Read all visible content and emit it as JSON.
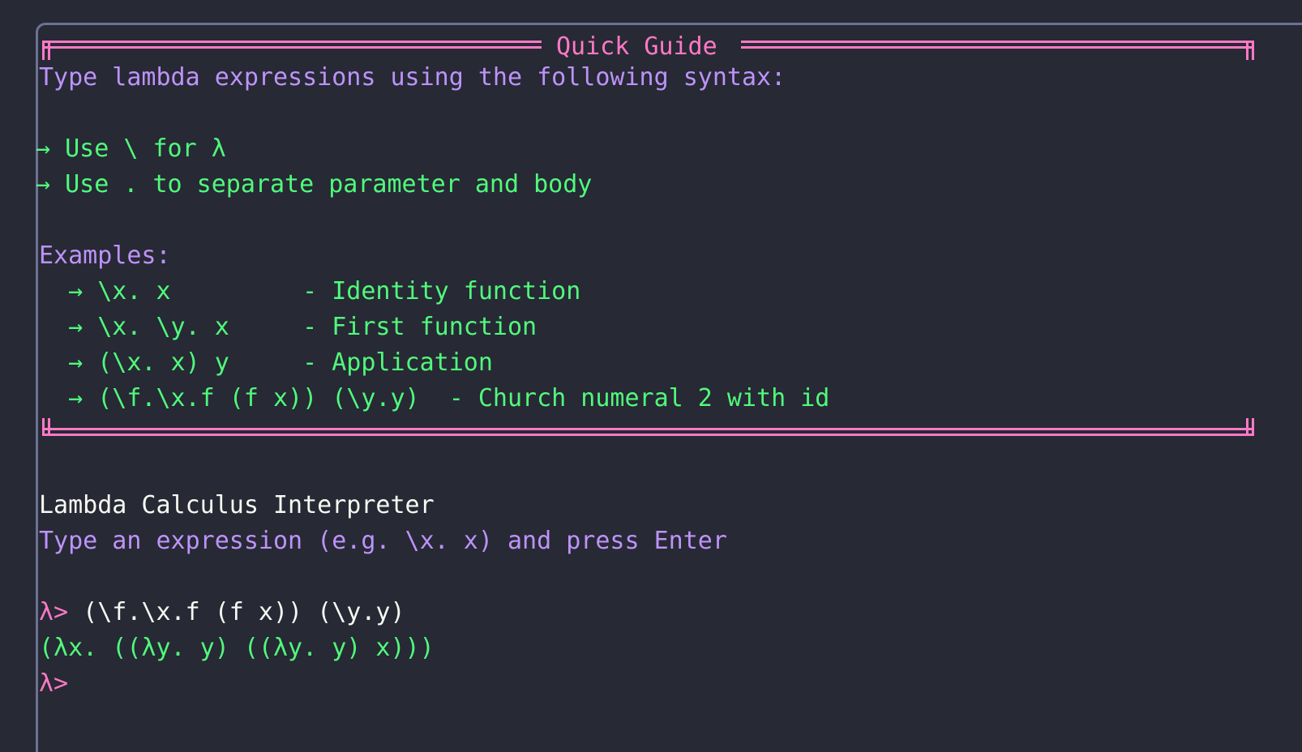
{
  "guide": {
    "title": "Quick Guide",
    "intro": "Type lambda expressions using the following syntax:",
    "rules": [
      "→ Use \\ for λ",
      "→ Use . to separate parameter and body"
    ],
    "examples_heading": "Examples:",
    "examples": [
      {
        "expr": "  → \\x. x         ",
        "desc": "- Identity function"
      },
      {
        "expr": "  → \\x. \\y. x     ",
        "desc": "- First function"
      },
      {
        "expr": "  → (\\x. x) y     ",
        "desc": "- Application"
      },
      {
        "expr": "  → (\\f.\\x.f (f x)) (\\y.y)  ",
        "desc": "- Church numeral 2 with id"
      }
    ]
  },
  "repl": {
    "title": "Lambda Calculus Interpreter",
    "hint": "Type an expression (e.g. \\x. x) and press Enter",
    "prompt": "λ>",
    "history": [
      {
        "input": " (\\f.\\x.f (f x)) (\\y.y)",
        "output": "(λx. ((λy. y) ((λy. y) x)))"
      }
    ],
    "current_input": ""
  },
  "colors": {
    "background": "#272935",
    "frame": "#ff79c6",
    "heading": "#bd93f9",
    "rule": "#50fa7b",
    "text": "#f8f8f2",
    "prompt": "#ff79c6"
  }
}
